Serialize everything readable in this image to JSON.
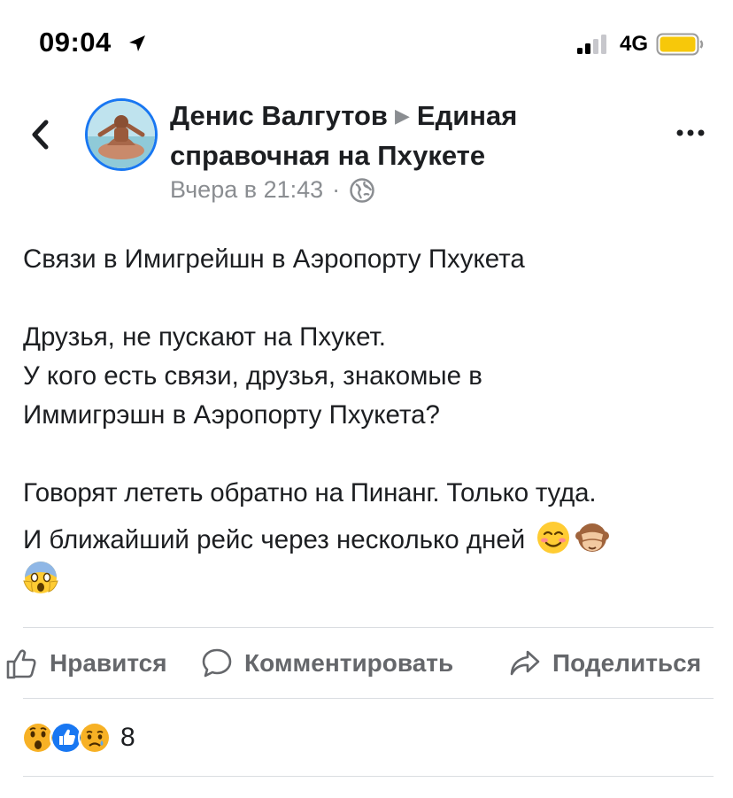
{
  "status_bar": {
    "time": "09:04",
    "network": "4G",
    "battery_color": "#f7c80a"
  },
  "post": {
    "author": "Денис Валгутов",
    "group": "Единая справочная на Пхукете",
    "timestamp": "Вчера в 21:43",
    "meta_separator": "·",
    "privacy_icon": "globe-icon",
    "body": {
      "line1": "Связи в Имигрейшн в Аэропорту Пхукета",
      "line2": "Друзья, не пускают на Пхукет.",
      "line3": "У кого есть связи, друзья, знакомые в",
      "line4": "Иммигрэшн в Аэропорту Пхукета?",
      "line5": "Говорят лететь обратно на Пинанг. Только туда.",
      "line6": "И ближайший рейс через несколько дней"
    },
    "emojis": [
      "smiling-face-icon",
      "see-no-evil-monkey-icon",
      "screaming-face-icon"
    ]
  },
  "actions": {
    "like_label": "Нравится",
    "comment_label": "Комментировать",
    "share_label": "Поделиться"
  },
  "reactions": {
    "icons": [
      "wow-reaction-icon",
      "like-reaction-icon",
      "sad-reaction-icon"
    ],
    "count": "8"
  },
  "colors": {
    "accent": "#1877f2",
    "secondary_text": "#65676b",
    "meta_text": "#8a8d91"
  }
}
